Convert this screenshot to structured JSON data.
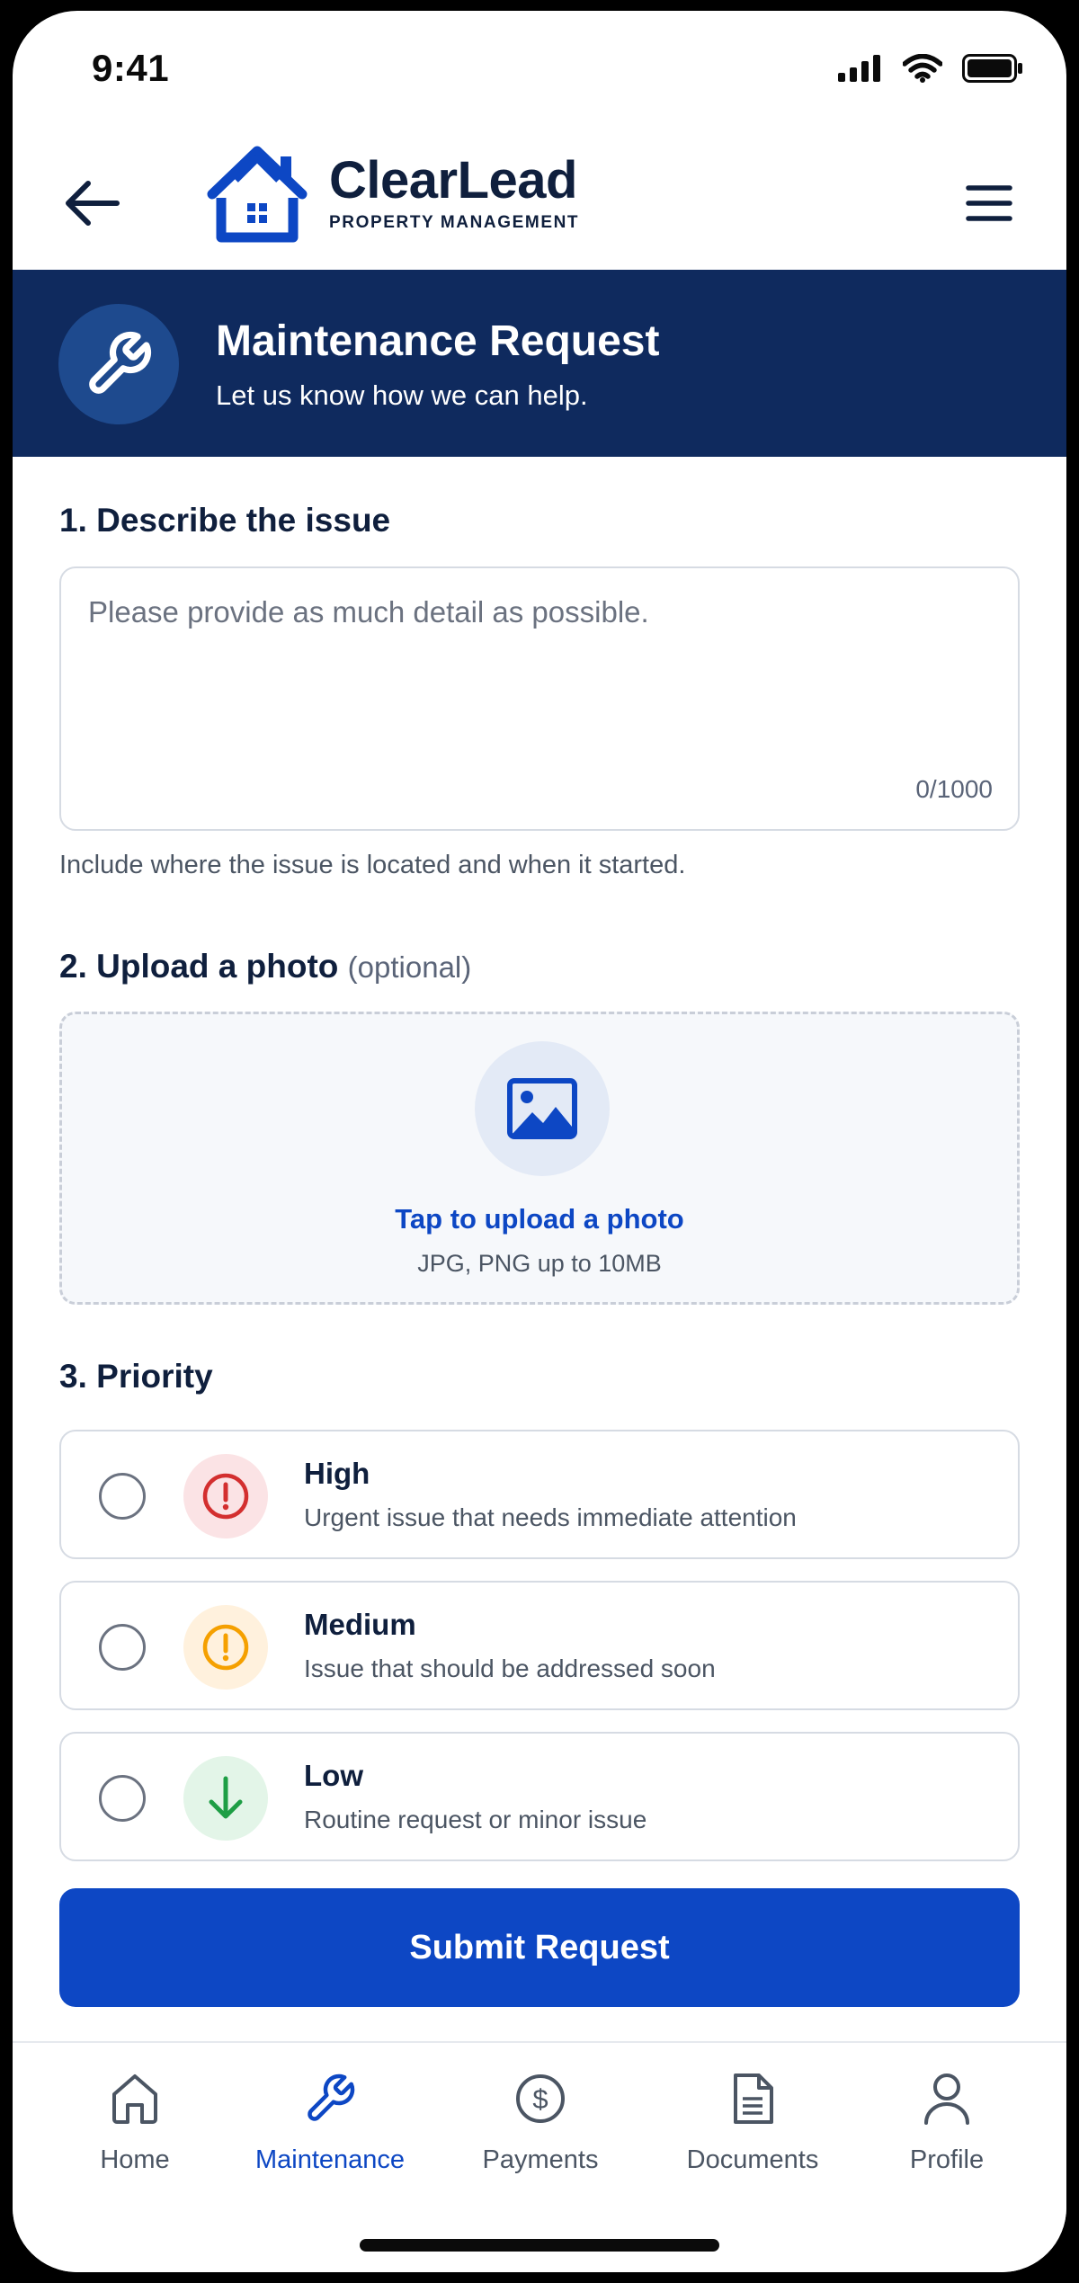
{
  "status_bar": {
    "time": "9:41"
  },
  "header": {
    "brand_name": "ClearLead",
    "brand_tagline": "PROPERTY MANAGEMENT"
  },
  "banner": {
    "title": "Maintenance Request",
    "subtitle": "Let us know how we can help.",
    "icon": "wrench-icon"
  },
  "describe": {
    "title": "1. Describe the issue",
    "placeholder": "Please provide as much detail as possible.",
    "value": "",
    "char_count": "0/1000",
    "helper": "Include where the issue is located and when it started."
  },
  "upload": {
    "title": "2. Upload a photo",
    "optional": "(optional)",
    "label": "Tap to upload a photo",
    "hint": "JPG, PNG up to 10MB",
    "icon": "image-icon"
  },
  "priority": {
    "title": "3. Priority",
    "options": [
      {
        "label": "High",
        "desc": "Urgent issue that needs immediate attention",
        "icon": "alert-circle-icon",
        "color": "#d32f2f",
        "bg": "#fbe3e5",
        "selected": false
      },
      {
        "label": "Medium",
        "desc": "Issue that should be addressed soon",
        "icon": "alert-circle-icon",
        "color": "#f5a000",
        "bg": "#fff1dd",
        "selected": false
      },
      {
        "label": "Low",
        "desc": "Routine request or minor issue",
        "icon": "arrow-down-icon",
        "color": "#1e9e45",
        "bg": "#e3f5e8",
        "selected": false
      }
    ]
  },
  "submit_label": "Submit Request",
  "nav": {
    "items": [
      {
        "label": "Home",
        "icon": "home-icon",
        "active": false
      },
      {
        "label": "Maintenance",
        "icon": "wrench-icon",
        "active": true
      },
      {
        "label": "Payments",
        "icon": "dollar-circle-icon",
        "active": false
      },
      {
        "label": "Documents",
        "icon": "document-icon",
        "active": false
      },
      {
        "label": "Profile",
        "icon": "user-icon",
        "active": false
      }
    ]
  },
  "colors": {
    "primary": "#0d47c4",
    "navy": "#0f2a5e",
    "text_dark": "#0f1f3d"
  }
}
